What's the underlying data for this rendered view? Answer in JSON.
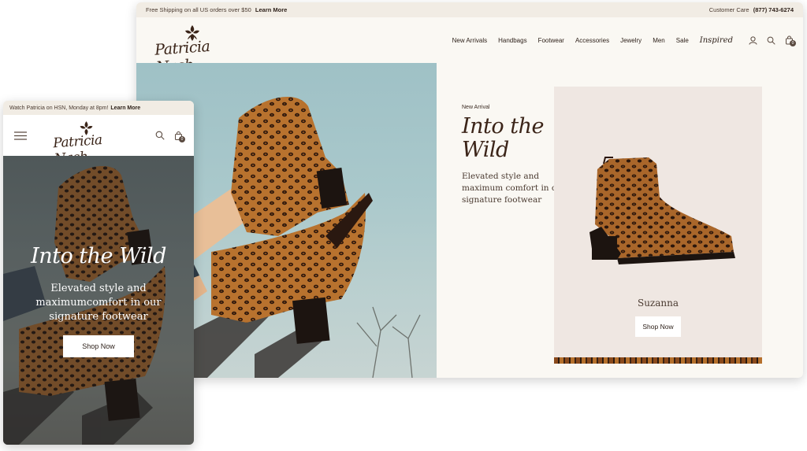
{
  "desktop": {
    "promo_text": "Free Shipping on all US orders over $50",
    "promo_link": "Learn More",
    "care_label": "Customer Care",
    "care_phone": "(877) 743-6274",
    "logo_text": "Patricia Nash",
    "nav": [
      "New Arrivals",
      "Handbags",
      "Footwear",
      "Accessories",
      "Jewelry",
      "Men",
      "Sale"
    ],
    "nav_script": "Inspired",
    "icons": [
      "user-icon",
      "search-icon",
      "bag-icon"
    ],
    "bag_count": "0",
    "hero": {
      "eyebrow": "New Arrival",
      "title": "Into the Wild",
      "subtitle": "Elevated style and maximum comfort in our signature footwear"
    },
    "product": {
      "name": "Suzanna",
      "cta": "Shop Now"
    }
  },
  "mobile": {
    "promo_text": "Watch Patricia on HSN, Monday at 8pm!",
    "promo_link": "Learn More",
    "logo_text": "Patricia Nash",
    "icons": [
      "menu-icon",
      "search-icon",
      "bag-icon"
    ],
    "bag_count": "0",
    "hero": {
      "title": "Into the Wild",
      "subtitle": "Elevated style and maximumcomfort in our signature footwear",
      "cta": "Shop Now"
    }
  },
  "colors": {
    "brand_brown": "#3a2418",
    "background": "#faf8f3",
    "topbar": "#f1ece4",
    "card": "#efe7e2",
    "sky": "#9fc1c6"
  }
}
